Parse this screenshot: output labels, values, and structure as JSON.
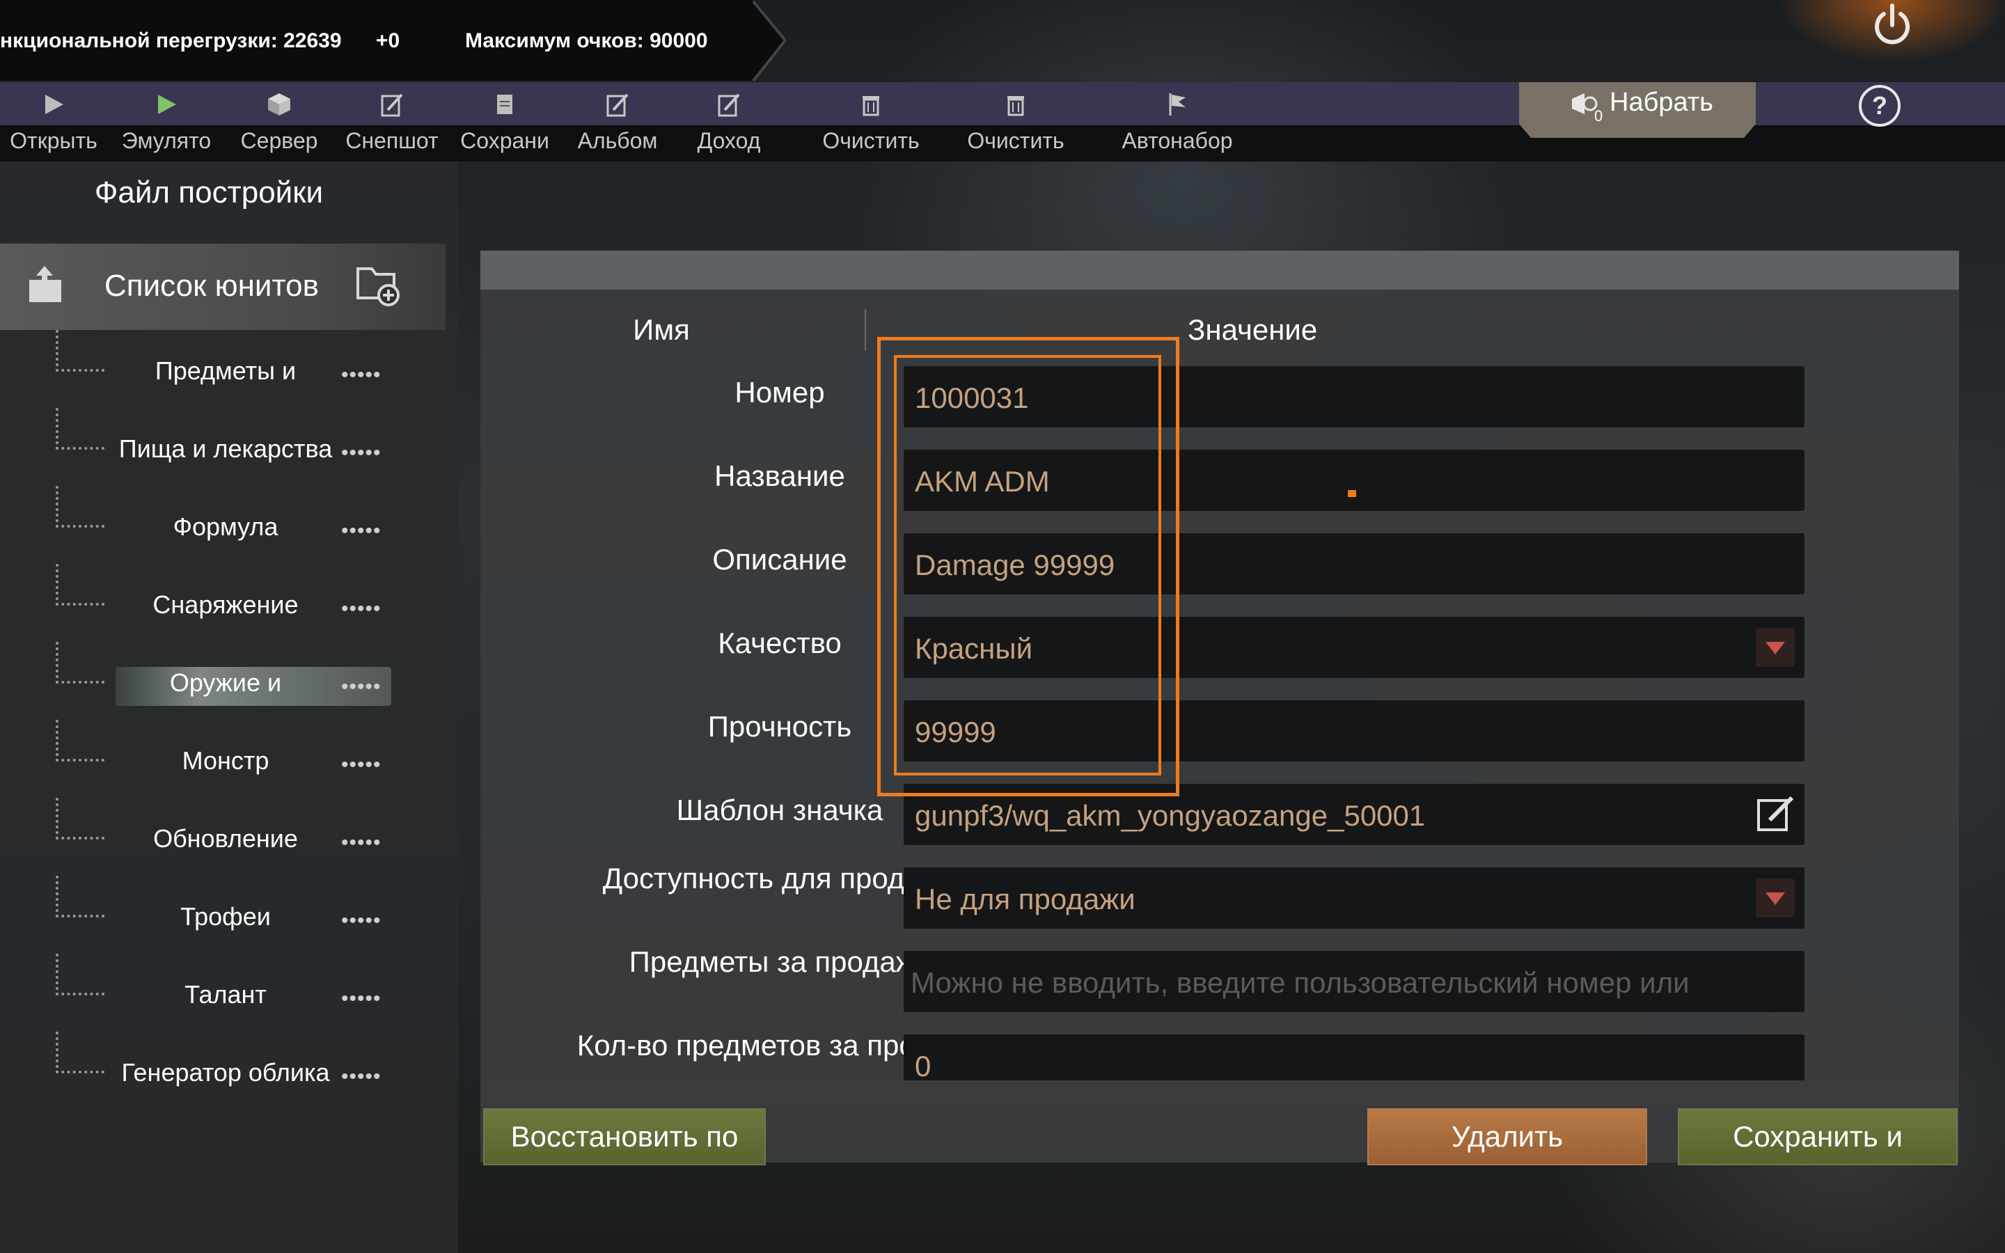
{
  "status_bar": {
    "overload_text": "нкциональной перегрузки: 22639",
    "delta": "+0",
    "max_points": "Максимум очков: 90000"
  },
  "toolbar": {
    "items": [
      {
        "label": "Открыть",
        "icon": "play-icon"
      },
      {
        "label": "Эмулято",
        "icon": "play-green-icon"
      },
      {
        "label": "Сервер",
        "icon": "box-icon"
      },
      {
        "label": "Снепшот",
        "icon": "edit-icon"
      },
      {
        "label": "Сохрани",
        "icon": "document-icon"
      },
      {
        "label": "Альбом",
        "icon": "edit-icon"
      },
      {
        "label": "Доход",
        "icon": "edit-icon"
      },
      {
        "label": "Очистить",
        "icon": "trash-icon"
      },
      {
        "label": "Очистить",
        "icon": "trash-icon"
      },
      {
        "label": "Автонабор",
        "icon": "flag-icon"
      }
    ],
    "nabrat_label": "Набрать",
    "nabrat_badge": "0"
  },
  "sidebar": {
    "title": "Файл постройки",
    "unit_list_label": "Список юнитов",
    "items": [
      {
        "label": "Предметы и",
        "selected": false
      },
      {
        "label": "Пища и лекарства",
        "selected": false
      },
      {
        "label": "Формула",
        "selected": false
      },
      {
        "label": "Снаряжение",
        "selected": false
      },
      {
        "label": "Оружие и",
        "selected": true
      },
      {
        "label": "Монстр",
        "selected": false
      },
      {
        "label": "Обновление",
        "selected": false
      },
      {
        "label": "Трофеи",
        "selected": false
      },
      {
        "label": "Талант",
        "selected": false
      },
      {
        "label": "Генератор облика",
        "selected": false
      }
    ],
    "dots": "•••••"
  },
  "form": {
    "col_name": "Имя",
    "col_value": "Значение",
    "rows": [
      {
        "label": "Номер",
        "value": "1000031",
        "type": "text"
      },
      {
        "label": "Название",
        "value": "AKM ADM",
        "type": "text"
      },
      {
        "label": "Описание",
        "value": "Damage 99999",
        "type": "text"
      },
      {
        "label": "Качество",
        "value": "Красный",
        "type": "select"
      },
      {
        "label": "Прочность",
        "value": "99999",
        "type": "text"
      },
      {
        "label": "Шаблон значка",
        "value": "gunpf3/wq_akm_yongyaozange_50001",
        "type": "edit"
      },
      {
        "label": "Доступность для продажи",
        "value": "Не для продажи",
        "type": "select"
      },
      {
        "label": "Предметы за продажу",
        "placeholder": "Можно не вводить, введите пользовательский номер или",
        "type": "text"
      },
      {
        "label": "Кол-во предметов за продажу",
        "value": "0",
        "type": "text"
      }
    ]
  },
  "buttons": {
    "restore": "Восстановить по",
    "delete": "Удалить",
    "save": "Сохранить и"
  },
  "colors": {
    "accent_highlight": "#f07b1d",
    "field_text": "#c5a27e",
    "toolbar_band": "#3a3550"
  }
}
